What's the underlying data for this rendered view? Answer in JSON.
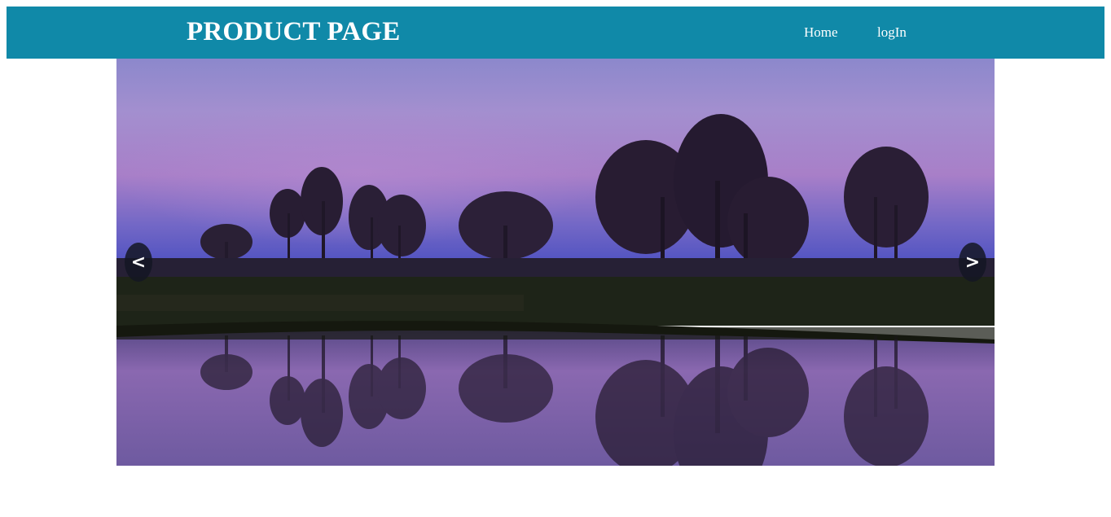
{
  "header": {
    "title": "PRODUCT PAGE",
    "nav": [
      {
        "label": "Home"
      },
      {
        "label": "logIn"
      }
    ]
  },
  "carousel": {
    "prev_label": "<",
    "next_label": ">",
    "slide_image": "lake-trees-dusk-reflection"
  },
  "colors": {
    "navbar": "#1089a8",
    "text": "#ffffff",
    "arrow_bg": "#14162a"
  }
}
